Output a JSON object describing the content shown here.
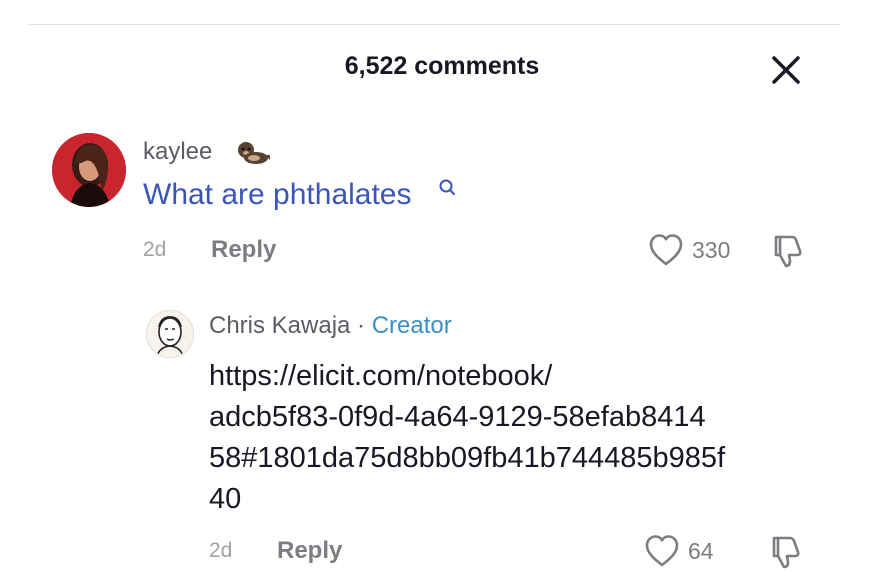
{
  "header": {
    "title": "6,522 comments"
  },
  "comment": {
    "username": "kaylee",
    "username_emoji": "otter-icon",
    "text": "What are phthalates",
    "age": "2d",
    "reply_label": "Reply",
    "likes": "330"
  },
  "reply": {
    "username": "Chris Kawaja",
    "separator": " · ",
    "badge": "Creator",
    "text_lines": [
      "https://elicit.com/notebook/",
      "adcb5f83-0f9d-4a64-9129-58efab8414",
      "58#1801da75d8bb09fb41b744485b985f",
      "40"
    ],
    "age": "2d",
    "reply_label": "Reply",
    "likes": "64"
  },
  "colors": {
    "link": "#3b56b7",
    "creator": "#3a8fc4",
    "muted": "#7c7d82"
  }
}
